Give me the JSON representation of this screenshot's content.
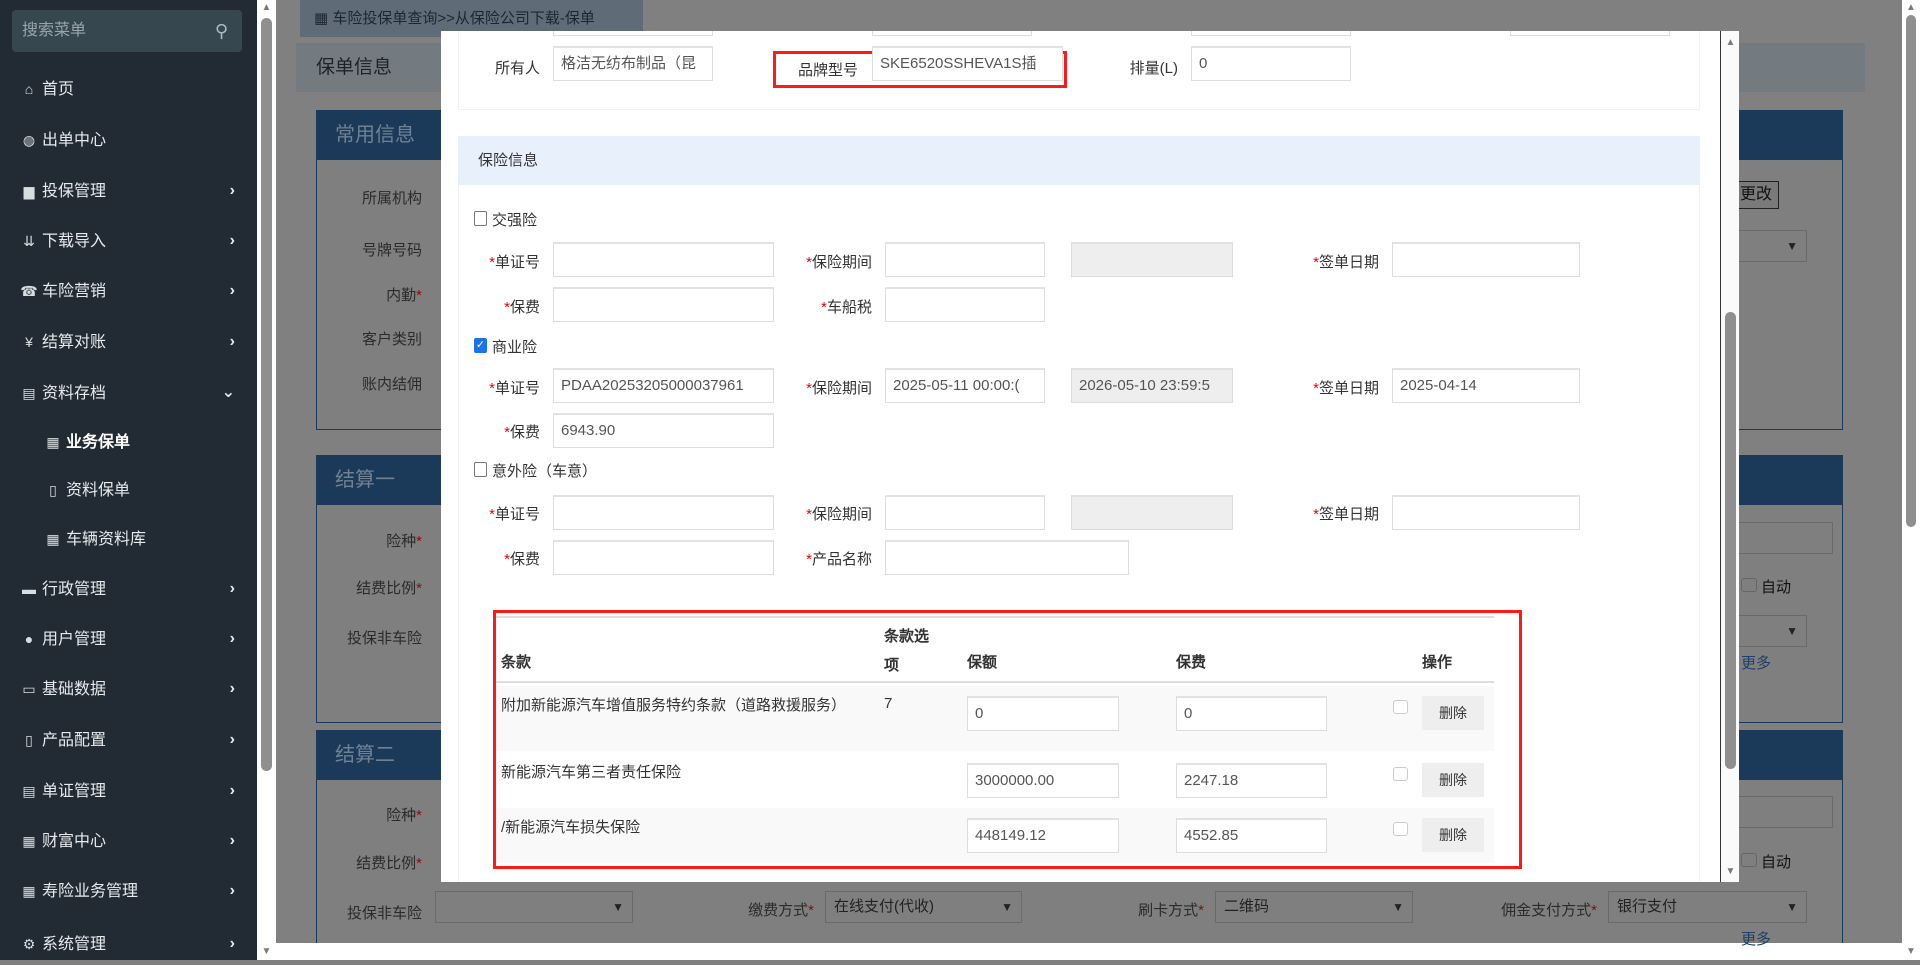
{
  "sidebar": {
    "search_placeholder": "搜索菜单",
    "items": [
      {
        "label": "首页",
        "icon": "home-icon",
        "glyph": "⌂"
      },
      {
        "label": "出单中心",
        "icon": "globe-icon",
        "glyph": "◍"
      },
      {
        "label": "投保管理",
        "icon": "file-icon",
        "glyph": "▆"
      },
      {
        "label": "下载导入",
        "icon": "download-icon",
        "glyph": "⇊"
      },
      {
        "label": "车险营销",
        "icon": "phone-icon",
        "glyph": "☎"
      },
      {
        "label": "结算对账",
        "icon": "yen-icon",
        "glyph": "¥"
      },
      {
        "label": "资料存档",
        "icon": "list-icon",
        "glyph": "▤"
      },
      {
        "label": "业务保单",
        "icon": "grid-icon",
        "glyph": "▦"
      },
      {
        "label": "资料保单",
        "icon": "book-icon",
        "glyph": "▯"
      },
      {
        "label": "车辆资料库",
        "icon": "grid-icon",
        "glyph": "▦"
      },
      {
        "label": "行政管理",
        "icon": "folder-icon",
        "glyph": "▬"
      },
      {
        "label": "用户管理",
        "icon": "user-icon",
        "glyph": "●"
      },
      {
        "label": "基础数据",
        "icon": "drive-icon",
        "glyph": "▭"
      },
      {
        "label": "产品配置",
        "icon": "book-icon",
        "glyph": "▯"
      },
      {
        "label": "单证管理",
        "icon": "list-icon",
        "glyph": "▤"
      },
      {
        "label": "财富中心",
        "icon": "grid-icon",
        "glyph": "▦"
      },
      {
        "label": "寿险业务管理",
        "icon": "grid-icon",
        "glyph": "▦"
      },
      {
        "label": "系统管理",
        "icon": "gear-icon",
        "glyph": "⚙"
      }
    ]
  },
  "breadcrumb": "车险投保单查询>>从保险公司下载-保单",
  "page": {
    "header": "保单信息",
    "panel_common": {
      "title": "常用信息",
      "labels": [
        "所属机构",
        "号牌号码",
        "内勤",
        "客户类别",
        "账内结佣"
      ],
      "change_button": "更改"
    },
    "panel_settle1": {
      "title": "结算一",
      "labels": [
        "险种",
        "结费比例",
        "投保非车险"
      ],
      "auto_label": "自动",
      "more": "更多"
    },
    "panel_settle2": {
      "title": "结算二",
      "labels": [
        "险种",
        "结费比例",
        "投保非车险"
      ],
      "auto_label": "自动",
      "pay_method_label": "缴费方式",
      "pay_method_value": "在线支付(代收)",
      "card_method_label": "刷卡方式",
      "card_method_value": "二维码",
      "commission_label": "佣金支付方式",
      "commission_value": "银行支付",
      "more": "更多"
    }
  },
  "modal": {
    "vehicle": {
      "owner_label": "所有人",
      "owner_value": "格洁无纺布制品（昆",
      "model_label": "品牌型号",
      "model_value": "SKE6520SSHEVA1S插",
      "displacement_label": "排量(L)",
      "displacement_value": "0"
    },
    "insurance_section_title": "保险信息",
    "compulsory": {
      "label": "交强险",
      "checked": false,
      "cert_label": "单证号",
      "cert_value": "",
      "period_label": "保险期间",
      "period_start": "",
      "period_end": "",
      "sign_label": "签单日期",
      "sign_value": "",
      "premium_label": "保费",
      "premium_value": "",
      "vessel_tax_label": "车船税",
      "vessel_tax_value": ""
    },
    "commercial": {
      "label": "商业险",
      "checked": true,
      "cert_label": "单证号",
      "cert_value": "PDAA20253205000037961",
      "period_label": "保险期间",
      "period_start": "2025-05-11 00:00:(",
      "period_end": "2026-05-10 23:59:5",
      "sign_label": "签单日期",
      "sign_value": "2025-04-14",
      "premium_label": "保费",
      "premium_value": "6943.90"
    },
    "accident": {
      "label": "意外险（车意）",
      "checked": false,
      "cert_label": "单证号",
      "cert_value": "",
      "period_label": "保险期间",
      "period_start": "",
      "period_end": "",
      "sign_label": "签单日期",
      "sign_value": "",
      "premium_label": "保费",
      "premium_value": "",
      "product_label": "产品名称",
      "product_value": ""
    },
    "clauses": {
      "headers": {
        "clause": "条款",
        "option_1": "条款选",
        "option_2": "项",
        "amount": "保额",
        "premium": "保费",
        "action": "操作"
      },
      "rows": [
        {
          "name": "附加新能源汽车增值服务特约条款（道路救援服务）",
          "option": "7",
          "amount": "0",
          "premium": "0",
          "action": "删除"
        },
        {
          "name": "新能源汽车第三者责任保险",
          "option": "",
          "amount": "3000000.00",
          "premium": "2247.18",
          "action": "删除"
        },
        {
          "name": "/新能源汽车损失保险",
          "option": "",
          "amount": "448149.12",
          "premium": "4552.85",
          "action": "删除"
        }
      ]
    }
  }
}
